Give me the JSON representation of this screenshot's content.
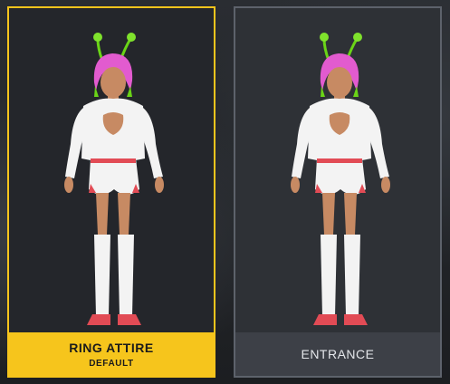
{
  "cards": [
    {
      "title": "RING ATTIRE",
      "subtitle": "DEFAULT",
      "selected": true
    },
    {
      "title": "ENTRANCE",
      "subtitle": "",
      "selected": false
    }
  ],
  "colors": {
    "accent": "#f6c51c",
    "card_border_inactive": "#5d626b",
    "hair": "#e25bcf",
    "antenna": "#6ad417",
    "outfit": "#f3f3f3",
    "trim": "#e24b55",
    "skin": "#c78a63"
  },
  "icons": {
    "character_render": "wrestler-figure"
  }
}
